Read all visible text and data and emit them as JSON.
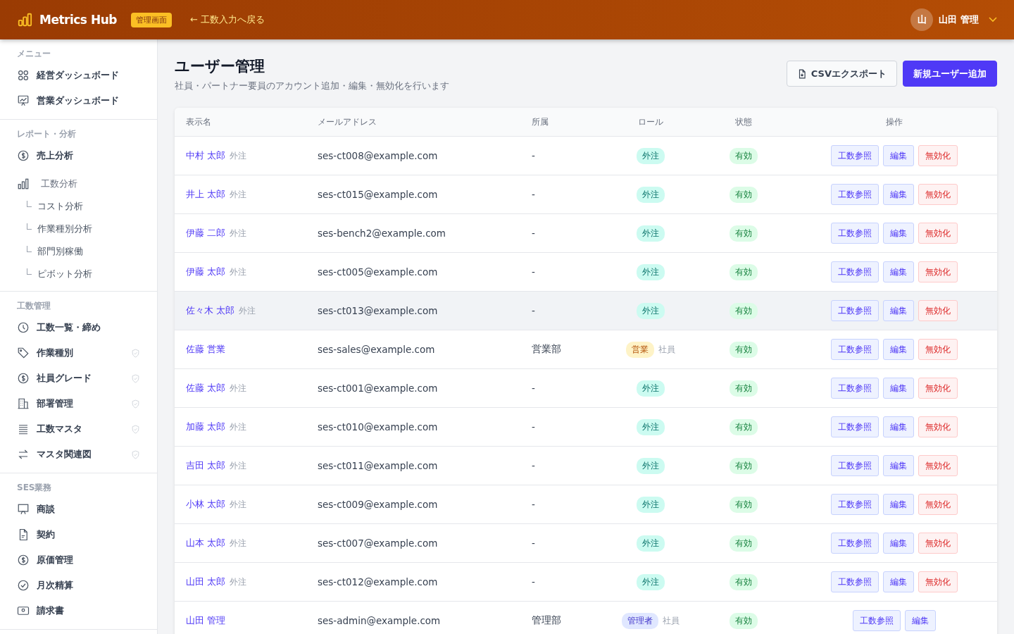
{
  "header": {
    "brand": "Metrics Hub",
    "badge": "管理画面",
    "back_link": "← 工数入力へ戻る",
    "user": {
      "avatar": "山",
      "name": "山田 管理"
    }
  },
  "sidebar": {
    "sections": [
      {
        "title": "メニュー",
        "items": [
          {
            "kind": "grid",
            "label": "経営ダッシュボード",
            "admin": false
          },
          {
            "kind": "chart",
            "label": "営業ダッシュボード",
            "admin": false
          }
        ]
      },
      {
        "title": "レポート・分析",
        "items": [
          {
            "kind": "dollar",
            "label": "売上分析",
            "admin": false
          },
          {
            "kind": "bars",
            "label": "工数分析",
            "admin": false,
            "children": [
              {
                "label": "コスト分析"
              },
              {
                "label": "作業種別分析"
              },
              {
                "label": "部門別稼働"
              },
              {
                "label": "ピボット分析"
              }
            ]
          }
        ]
      },
      {
        "title": "工数管理",
        "items": [
          {
            "kind": "clock",
            "label": "工数一覧・締め",
            "admin": false
          },
          {
            "kind": "tag",
            "label": "作業種別",
            "admin": true
          },
          {
            "kind": "dollar",
            "label": "社員グレード",
            "admin": true
          },
          {
            "kind": "building",
            "label": "部署管理",
            "admin": true
          },
          {
            "kind": "lines",
            "label": "工数マスタ",
            "admin": true
          },
          {
            "kind": "swap",
            "label": "マスタ関連図",
            "admin": true
          }
        ]
      },
      {
        "title": "SES業務",
        "items": [
          {
            "kind": "monitor",
            "label": "商談",
            "admin": false
          },
          {
            "kind": "doc",
            "label": "契約",
            "admin": false
          },
          {
            "kind": "dollar",
            "label": "原価管理",
            "admin": false
          },
          {
            "kind": "check",
            "label": "月次精算",
            "admin": false
          },
          {
            "kind": "card",
            "label": "請求書",
            "admin": false
          }
        ]
      }
    ]
  },
  "page": {
    "title": "ユーザー管理",
    "subtitle": "社員・パートナー要員のアカウント追加・編集・無効化を行います",
    "buttons": [
      {
        "kind": "secondary",
        "label": "CSVエクスポート"
      },
      {
        "kind": "primary",
        "label": "新規ユーザー追加"
      }
    ]
  },
  "table": {
    "columns": [
      "表示名",
      "メールアドレス",
      "所属",
      "ロール",
      "状態",
      "操作"
    ],
    "rows": [
      {
        "name": "中村 太郎",
        "name_tag": "外注",
        "email": "ses-ct008@example.com",
        "dept": "-",
        "role": {
          "kind": "outsource",
          "label": "外注"
        },
        "status": "有効",
        "highlighted": false,
        "actions": [
          {
            "kind": "view",
            "label": "工数参照"
          },
          {
            "kind": "edit",
            "label": "編集"
          },
          {
            "kind": "disable",
            "label": "無効化"
          }
        ]
      },
      {
        "name": "井上 太郎",
        "name_tag": "外注",
        "email": "ses-ct015@example.com",
        "dept": "-",
        "role": {
          "kind": "outsource",
          "label": "外注"
        },
        "status": "有効",
        "highlighted": false,
        "actions": [
          {
            "kind": "view",
            "label": "工数参照"
          },
          {
            "kind": "edit",
            "label": "編集"
          },
          {
            "kind": "disable",
            "label": "無効化"
          }
        ]
      },
      {
        "name": "伊藤 二郎",
        "name_tag": "外注",
        "email": "ses-bench2@example.com",
        "dept": "-",
        "role": {
          "kind": "outsource",
          "label": "外注"
        },
        "status": "有効",
        "highlighted": false,
        "actions": [
          {
            "kind": "view",
            "label": "工数参照"
          },
          {
            "kind": "edit",
            "label": "編集"
          },
          {
            "kind": "disable",
            "label": "無効化"
          }
        ]
      },
      {
        "name": "伊藤 太郎",
        "name_tag": "外注",
        "email": "ses-ct005@example.com",
        "dept": "-",
        "role": {
          "kind": "outsource",
          "label": "外注"
        },
        "status": "有効",
        "highlighted": false,
        "actions": [
          {
            "kind": "view",
            "label": "工数参照"
          },
          {
            "kind": "edit",
            "label": "編集"
          },
          {
            "kind": "disable",
            "label": "無効化"
          }
        ]
      },
      {
        "name": "佐々木 太郎",
        "name_tag": "外注",
        "email": "ses-ct013@example.com",
        "dept": "-",
        "role": {
          "kind": "outsource",
          "label": "外注"
        },
        "status": "有効",
        "highlighted": true,
        "actions": [
          {
            "kind": "view",
            "label": "工数参照"
          },
          {
            "kind": "edit",
            "label": "編集"
          },
          {
            "kind": "disable",
            "label": "無効化"
          }
        ]
      },
      {
        "name": "佐藤 営業",
        "email": "ses-sales@example.com",
        "dept": "営業部",
        "role": {
          "kind": "sales",
          "label": "営業",
          "type": "社員"
        },
        "status": "有効",
        "highlighted": false,
        "actions": [
          {
            "kind": "view",
            "label": "工数参照"
          },
          {
            "kind": "edit",
            "label": "編集"
          },
          {
            "kind": "disable",
            "label": "無効化"
          }
        ]
      },
      {
        "name": "佐藤 太郎",
        "name_tag": "外注",
        "email": "ses-ct001@example.com",
        "dept": "-",
        "role": {
          "kind": "outsource",
          "label": "外注"
        },
        "status": "有効",
        "highlighted": false,
        "actions": [
          {
            "kind": "view",
            "label": "工数参照"
          },
          {
            "kind": "edit",
            "label": "編集"
          },
          {
            "kind": "disable",
            "label": "無効化"
          }
        ]
      },
      {
        "name": "加藤 太郎",
        "name_tag": "外注",
        "email": "ses-ct010@example.com",
        "dept": "-",
        "role": {
          "kind": "outsource",
          "label": "外注"
        },
        "status": "有効",
        "highlighted": false,
        "actions": [
          {
            "kind": "view",
            "label": "工数参照"
          },
          {
            "kind": "edit",
            "label": "編集"
          },
          {
            "kind": "disable",
            "label": "無効化"
          }
        ]
      },
      {
        "name": "吉田 太郎",
        "name_tag": "外注",
        "email": "ses-ct011@example.com",
        "dept": "-",
        "role": {
          "kind": "outsource",
          "label": "外注"
        },
        "status": "有効",
        "highlighted": false,
        "actions": [
          {
            "kind": "view",
            "label": "工数参照"
          },
          {
            "kind": "edit",
            "label": "編集"
          },
          {
            "kind": "disable",
            "label": "無効化"
          }
        ]
      },
      {
        "name": "小林 太郎",
        "name_tag": "外注",
        "email": "ses-ct009@example.com",
        "dept": "-",
        "role": {
          "kind": "outsource",
          "label": "外注"
        },
        "status": "有効",
        "highlighted": false,
        "actions": [
          {
            "kind": "view",
            "label": "工数参照"
          },
          {
            "kind": "edit",
            "label": "編集"
          },
          {
            "kind": "disable",
            "label": "無効化"
          }
        ]
      },
      {
        "name": "山本 太郎",
        "name_tag": "外注",
        "email": "ses-ct007@example.com",
        "dept": "-",
        "role": {
          "kind": "outsource",
          "label": "外注"
        },
        "status": "有効",
        "highlighted": false,
        "actions": [
          {
            "kind": "view",
            "label": "工数参照"
          },
          {
            "kind": "edit",
            "label": "編集"
          },
          {
            "kind": "disable",
            "label": "無効化"
          }
        ]
      },
      {
        "name": "山田 太郎",
        "name_tag": "外注",
        "email": "ses-ct012@example.com",
        "dept": "-",
        "role": {
          "kind": "outsource",
          "label": "外注"
        },
        "status": "有効",
        "highlighted": false,
        "actions": [
          {
            "kind": "view",
            "label": "工数参照"
          },
          {
            "kind": "edit",
            "label": "編集"
          },
          {
            "kind": "disable",
            "label": "無効化"
          }
        ]
      },
      {
        "name": "山田 管理",
        "email": "ses-admin@example.com",
        "dept": "管理部",
        "role": {
          "kind": "admin",
          "label": "管理者",
          "type": "社員"
        },
        "status": "有効",
        "highlighted": false,
        "actions": [
          {
            "kind": "view",
            "label": "工数参照"
          },
          {
            "kind": "edit",
            "label": "編集"
          }
        ]
      }
    ]
  }
}
